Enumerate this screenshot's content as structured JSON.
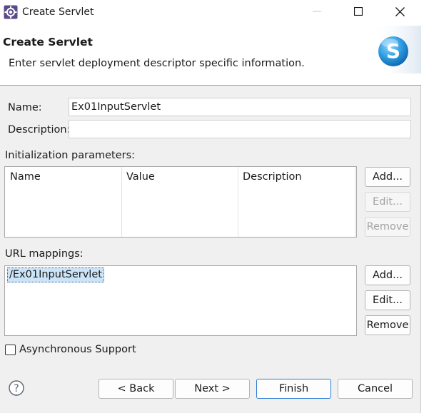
{
  "window": {
    "title": "Create Servlet"
  },
  "banner": {
    "title": "Create Servlet",
    "description": "Enter servlet deployment descriptor specific information.",
    "logo_letter": "S"
  },
  "form": {
    "name_label": "Name:",
    "name_value": "Ex01InputServlet",
    "description_label": "Description:",
    "description_value": ""
  },
  "init_params": {
    "label": "Initialization parameters:",
    "columns": [
      "Name",
      "Value",
      "Description"
    ],
    "buttons": {
      "add": "Add...",
      "edit": "Edit...",
      "remove": "Remove"
    }
  },
  "url_mappings": {
    "label": "URL mappings:",
    "items": [
      "/Ex01InputServlet"
    ],
    "buttons": {
      "add": "Add...",
      "edit": "Edit...",
      "remove": "Remove"
    }
  },
  "async": {
    "label": "Asynchronous Support",
    "checked": false
  },
  "footer": {
    "back": "< Back",
    "next": "Next >",
    "finish": "Finish",
    "cancel": "Cancel"
  },
  "icons": {
    "app": "eclipse-gear-icon",
    "minimize": "minimize-icon",
    "maximize": "maximize-icon",
    "close": "close-icon",
    "help": "help-icon"
  },
  "colors": {
    "accent": "#2b7ad6",
    "selection": "#cce4f7",
    "logo": "#1e8fd6"
  }
}
